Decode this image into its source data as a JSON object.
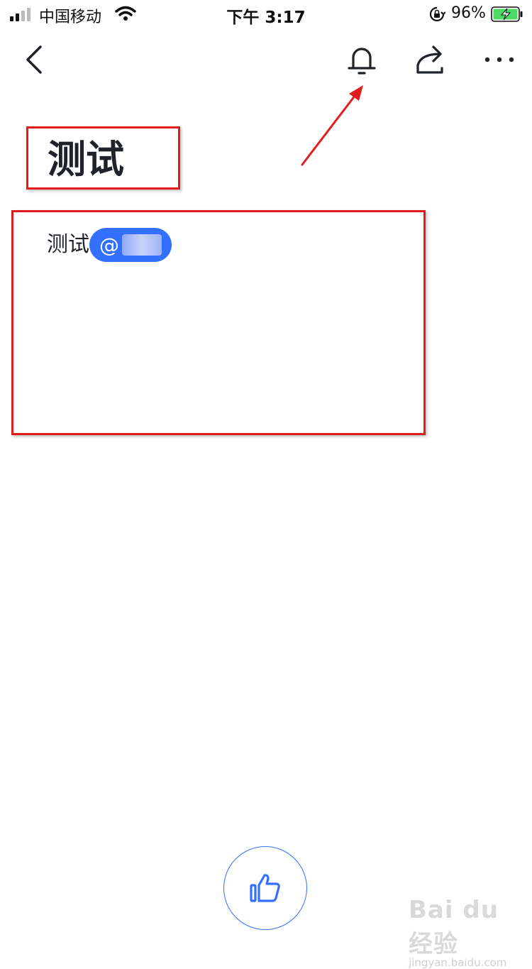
{
  "status_bar": {
    "carrier": "中国移动",
    "time": "下午 3:17",
    "battery_percent": "96%",
    "icons": [
      "signal-icon",
      "wifi-icon",
      "rotation-lock-icon",
      "battery-charging-icon"
    ]
  },
  "nav": {
    "icons": [
      "back-icon",
      "bell-icon",
      "share-icon",
      "more-icon"
    ]
  },
  "document": {
    "title": "测试",
    "body_text": "测试",
    "mention_prefix": "@"
  },
  "footer": {
    "like_icon": "thumbs-up-icon"
  },
  "watermark": {
    "logo": "Bai du 经验",
    "url": "jingyan.baidu.com"
  },
  "colors": {
    "accent": "#3370ff",
    "annotation": "#e21c1c",
    "battery": "#4cd964"
  }
}
